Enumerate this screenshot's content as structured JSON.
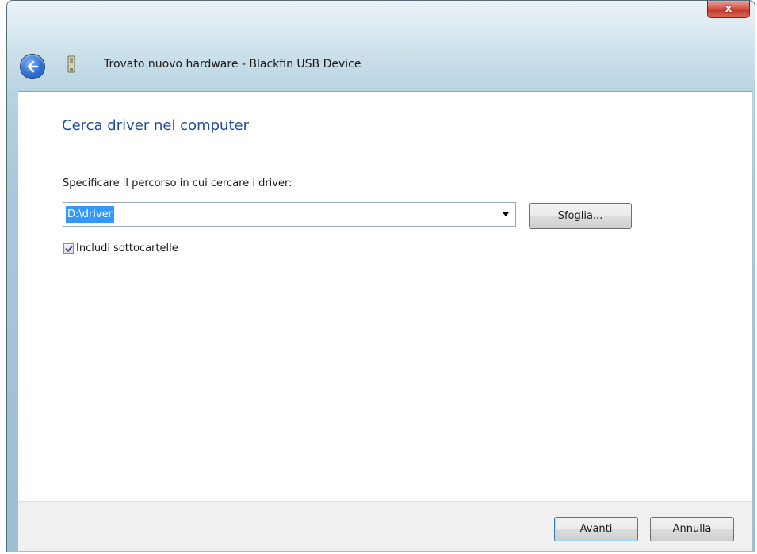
{
  "window": {
    "close_label": "x",
    "title": "Trovato nuovo hardware - Blackfin USB Device"
  },
  "page": {
    "heading": "Cerca driver nel computer",
    "path_label": "Specificare il percorso in cui cercare i driver:",
    "path_value": "D:\\driver",
    "browse_label": "Sfoglia...",
    "include_subfolders_label": "Includi sottocartelle",
    "include_subfolders_checked": true
  },
  "footer": {
    "next_label": "Avanti",
    "cancel_label": "Annulla"
  },
  "icons": {
    "back": "back-arrow-icon",
    "device": "usb-device-icon",
    "checkmark": "checkmark-icon",
    "dropdown": "chevron-down-icon"
  },
  "colors": {
    "heading": "#1e4e9a",
    "selection": "#3399ff",
    "close": "#c0392b"
  }
}
